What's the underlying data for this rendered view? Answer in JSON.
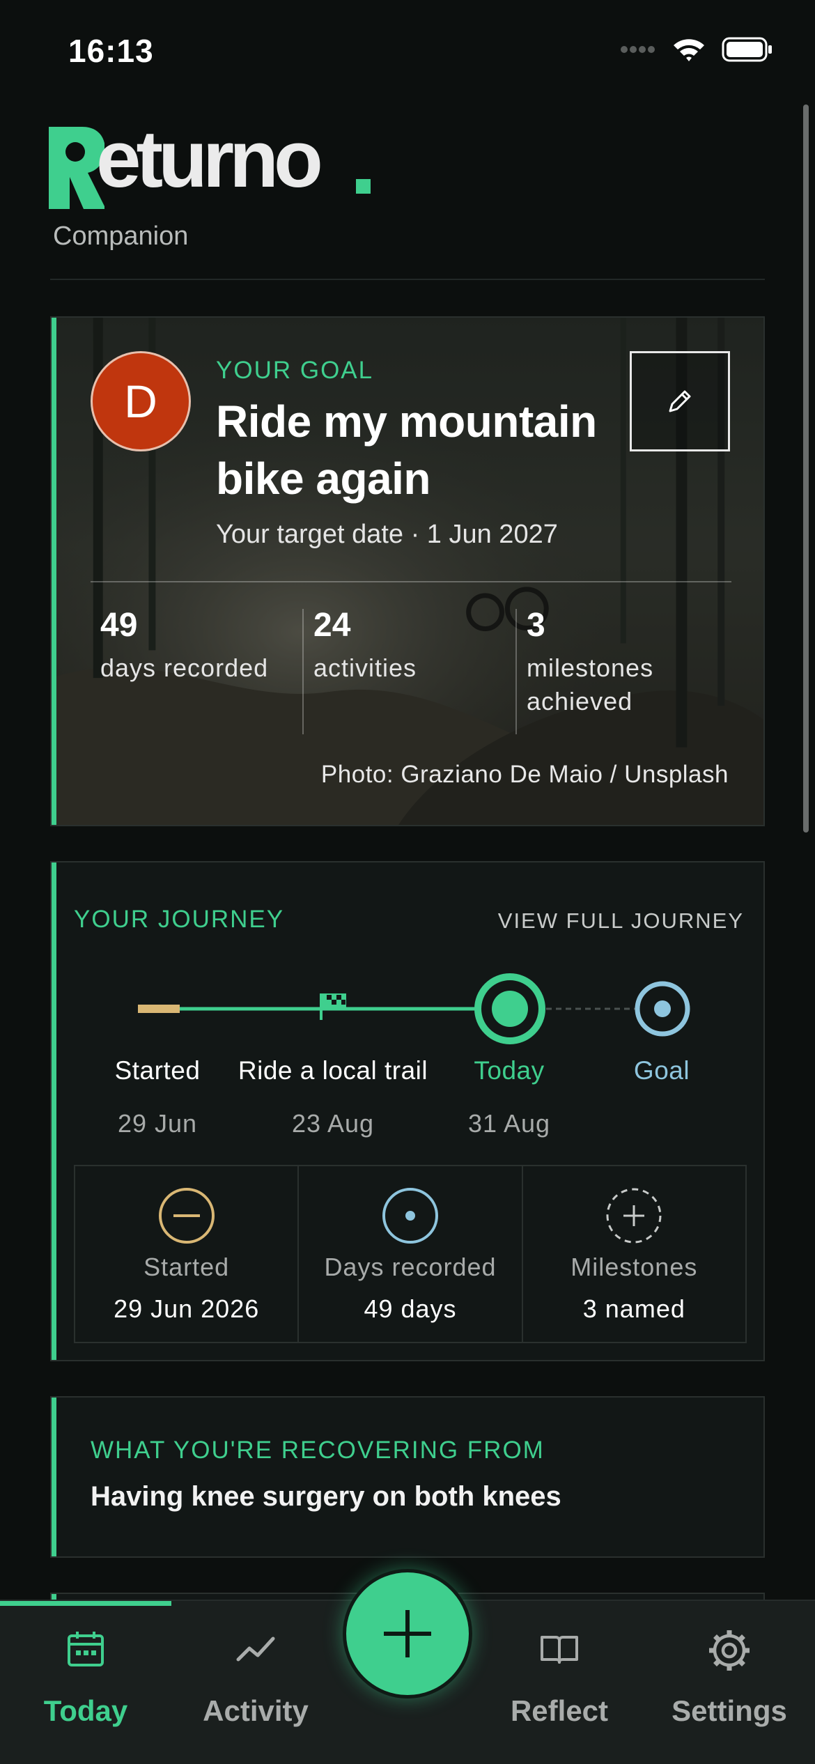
{
  "status_bar": {
    "time": "16:13"
  },
  "brand": {
    "name": "Returno",
    "subtitle": "Companion",
    "accent_color": "#3fcf8e"
  },
  "goal": {
    "kicker": "YOUR GOAL",
    "title": "Ride my mountain bike again",
    "target_date": "Your target date · 1 Jun 2027",
    "avatar_initial": "D",
    "avatar_color": "#c0360e",
    "edit_icon": "pencil-icon",
    "stats": [
      {
        "value": "49",
        "label": "days recorded"
      },
      {
        "value": "24",
        "label": "activities"
      },
      {
        "value": "3",
        "label": "milestones achieved"
      }
    ],
    "photo_credit": "Photo: Graziano De Maio / Unsplash"
  },
  "journey": {
    "title": "YOUR JOURNEY",
    "link": "VIEW FULL JOURNEY",
    "points": [
      {
        "label": "Started",
        "date": "29 Jun",
        "icon": "start-bar-icon"
      },
      {
        "label": "Ride a local trail",
        "date": "23 Aug",
        "icon": "flag-icon"
      },
      {
        "label": "Today",
        "date": "31 Aug",
        "icon": "today-marker-icon"
      },
      {
        "label": "Goal",
        "date": "",
        "icon": "goal-target-icon"
      }
    ],
    "summary": [
      {
        "label": "Started",
        "value": "29 Jun 2026",
        "icon": "minus-circle-icon"
      },
      {
        "label": "Days recorded",
        "value": "49 days",
        "icon": "dot-circle-icon"
      },
      {
        "label": "Milestones",
        "value": "3 named",
        "icon": "plus-dashed-circle-icon"
      }
    ]
  },
  "recovery": {
    "kicker": "WHAT YOU'RE RECOVERING FROM",
    "text": "Having knee surgery on both knees"
  },
  "tabs": [
    {
      "label": "Today",
      "icon": "calendar-icon",
      "active": true
    },
    {
      "label": "Activity",
      "icon": "chart-line-icon",
      "active": false
    },
    {
      "label": "Reflect",
      "icon": "book-icon",
      "active": false
    },
    {
      "label": "Settings",
      "icon": "gear-icon",
      "active": false
    }
  ],
  "fab": {
    "icon": "plus-icon"
  }
}
